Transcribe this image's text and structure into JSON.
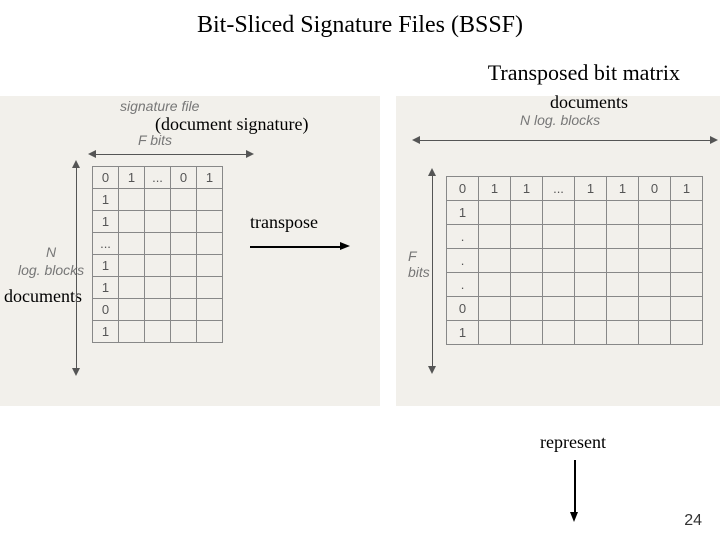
{
  "title": "Bit-Sliced Signature Files (BSSF)",
  "subtitle": "Transposed bit matrix",
  "labels": {
    "doc_sig": "(document signature)",
    "documents_top": "documents",
    "documents_left": "documents",
    "transpose": "transpose",
    "represent": "represent"
  },
  "left_fig": {
    "caption_top": "signature file",
    "f_bits": "F bits",
    "n_label": "N",
    "log_blocks": "log. blocks",
    "rows": [
      [
        "0",
        "1",
        "...",
        "0",
        "1"
      ],
      [
        "1",
        "",
        "",
        "",
        ""
      ],
      [
        "1",
        "",
        "",
        "",
        ""
      ],
      [
        "...",
        "",
        "",
        "",
        ""
      ],
      [
        "1",
        "",
        "",
        "",
        ""
      ],
      [
        "1",
        "",
        "",
        "",
        ""
      ],
      [
        "0",
        "",
        "",
        "",
        ""
      ],
      [
        "1",
        "",
        "",
        "",
        ""
      ]
    ]
  },
  "right_fig": {
    "n_log_blocks": "N log. blocks",
    "f_bits_label": "F\nbits",
    "rows": [
      [
        "0",
        "1",
        "1",
        "...",
        "1",
        "1",
        "0",
        "1"
      ],
      [
        "1",
        "",
        "",
        "",
        "",
        "",
        "",
        ""
      ],
      [
        ".",
        "",
        "",
        "",
        "",
        "",
        "",
        ""
      ],
      [
        ".",
        "",
        "",
        "",
        "",
        "",
        "",
        ""
      ],
      [
        ".",
        "",
        "",
        "",
        "",
        "",
        "",
        ""
      ],
      [
        "0",
        "",
        "",
        "",
        "",
        "",
        "",
        ""
      ],
      [
        "1",
        "",
        "",
        "",
        "",
        "",
        "",
        ""
      ]
    ]
  },
  "slide_number": "24"
}
